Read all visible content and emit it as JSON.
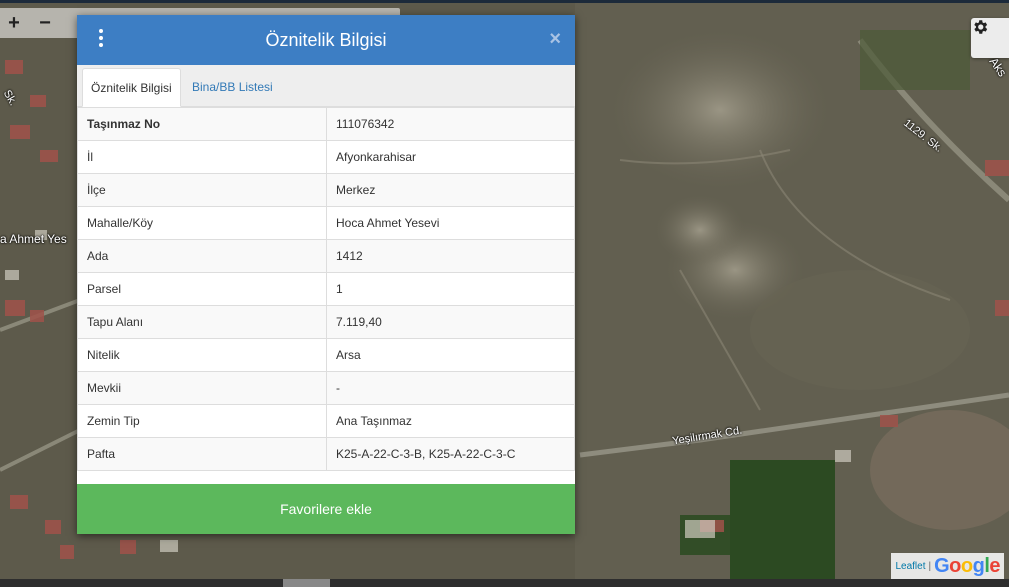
{
  "map": {
    "labels": {
      "street_1129": "1129. Sk.",
      "street_yesilirmak": "Yeşilırmak Cd.",
      "left_label": "a Ahmet Yes",
      "top_right_label": "Aks",
      "small_sk": "Sk."
    },
    "zoom": {
      "plus": "+",
      "minus": "−"
    },
    "attribution": {
      "leaflet": "Leaflet",
      "separator": "|",
      "google": "Google"
    }
  },
  "dialog": {
    "title": "Öznitelik Bilgisi",
    "close": "×",
    "tabs": [
      {
        "label": "Öznitelik Bilgisi",
        "active": true
      },
      {
        "label": "Bina/BB Listesi",
        "active": false
      }
    ],
    "rows": [
      {
        "key": "Taşınmaz No",
        "value": "111076342"
      },
      {
        "key": "İl",
        "value": "Afyonkarahisar"
      },
      {
        "key": "İlçe",
        "value": "Merkez"
      },
      {
        "key": "Mahalle/Köy",
        "value": "Hoca Ahmet Yesevi"
      },
      {
        "key": "Ada",
        "value": "1412"
      },
      {
        "key": "Parsel",
        "value": "1"
      },
      {
        "key": "Tapu Alanı",
        "value": "7.119,40"
      },
      {
        "key": "Nitelik",
        "value": "Arsa"
      },
      {
        "key": "Mevkii",
        "value": "-"
      },
      {
        "key": "Zemin Tip",
        "value": "Ana Taşınmaz"
      },
      {
        "key": "Pafta",
        "value": "K25-A-22-C-3-B, K25-A-22-C-3-C"
      }
    ],
    "favorite_button": "Favorilere ekle"
  },
  "colors": {
    "header": "#3d7ec4",
    "favorite": "#5cb85c",
    "tab_link": "#337ab7"
  }
}
